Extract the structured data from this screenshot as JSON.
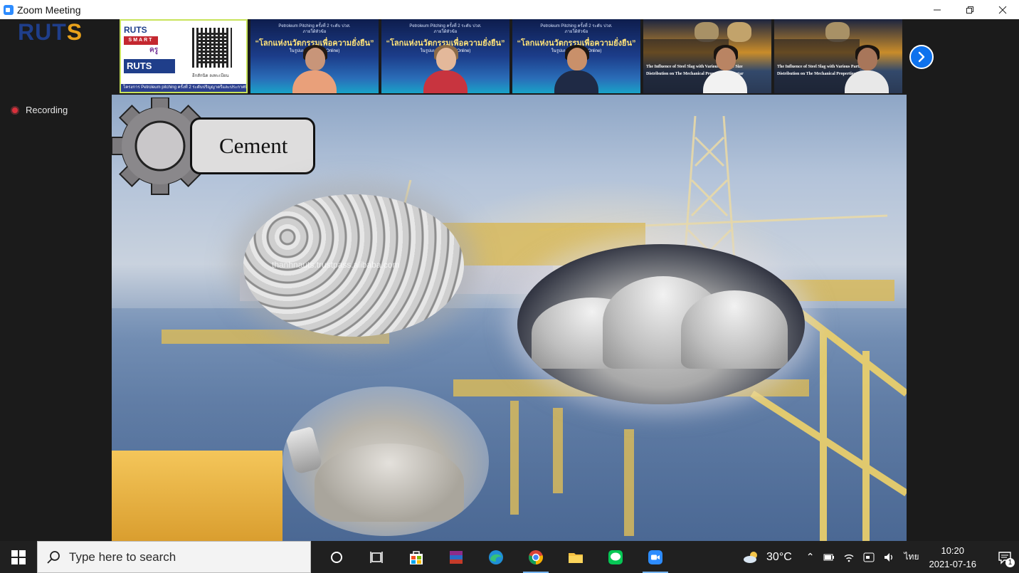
{
  "window": {
    "title": "Zoom Meeting",
    "controls": [
      "minimize",
      "restore",
      "close"
    ]
  },
  "meeting": {
    "logo_text_main": "RUT",
    "logo_text_accent": "S",
    "recording_label": "Recording",
    "next_page_icon": "chevron-right-icon"
  },
  "thumbnails": [
    {
      "type": "poster",
      "rut_small": "RUTS",
      "smart": "SMART",
      "khru": "ครู",
      "ruts_big": "RUTS",
      "caption": "อีกสักนิด ลงทะเบียน",
      "footer": "โครงการ Petroleum pitching ครั้งที่ 2 ระดับปริญญาตรีและประกาศนียบัตรวิชาชีพชั้นสูง"
    },
    {
      "type": "person",
      "line1": "Petroleum Pitching ครั้งที่ 2 ระดับ ปวส.",
      "line2": "ภายใต้หัวข้อ",
      "headline": "“โลกแห่งนวัตกรรมเพื่อความยั่งยืน”",
      "sub": "ในรูปแบบออนไลน์ (Online)",
      "skin": "#c89579",
      "hair": "#241a14",
      "shirt": "#e9a07a"
    },
    {
      "type": "person",
      "line1": "Petroleum Pitching ครั้งที่ 2 ระดับ ปวส.",
      "line2": "ภายใต้หัวข้อ",
      "headline": "“โลกแห่งนวัตกรรมเพื่อความยั่งยืน”",
      "sub": "ในรูปแบบออนไลน์ (Online)",
      "skin": "#e3b89a",
      "hair": "#8a6a48",
      "shirt": "#c8343f"
    },
    {
      "type": "person",
      "line1": "Petroleum Pitching ครั้งที่ 2 ระดับ ปวส.",
      "line2": "ภายใต้หัวข้อ",
      "headline": "“โลกแห่งนวัตกรรมเพื่อความยั่งยืน”",
      "sub": "ในรูปแบบออนไลน์ (Online)",
      "skin": "#c9906a",
      "hair": "#1c1612",
      "shirt": "#1f2a45"
    },
    {
      "type": "oil",
      "text1": "The Influence of Steel Slag with Various Particle Size",
      "text2": "Distribution on The Mechanical Properties of Mortar",
      "skin": "#b98463",
      "hair": "#1a1410",
      "shirt": "#f2f2f2"
    },
    {
      "type": "oil",
      "text1": "The Influence of Steel Slag with Various Particle Size",
      "text2": "Distribution on The Mechanical Properties of Mortar",
      "skin": "#a8765a",
      "hair": "#1a1410",
      "shirt": "#e8e8e8"
    }
  ],
  "slide": {
    "title": "Cement",
    "watermark": "thanhnauts.trustpass.alibaba.com"
  },
  "taskbar": {
    "search_placeholder": "Type here to search",
    "apps": [
      {
        "name": "task-view-icon",
        "running": false
      },
      {
        "name": "task-switch-icon",
        "running": false
      },
      {
        "name": "store-icon",
        "running": false
      },
      {
        "name": "winrar-icon",
        "running": false
      },
      {
        "name": "edge-icon",
        "running": false
      },
      {
        "name": "chrome-icon",
        "running": true
      },
      {
        "name": "file-explorer-icon",
        "running": false
      },
      {
        "name": "line-icon",
        "running": false
      },
      {
        "name": "zoom-icon",
        "running": true
      }
    ],
    "weather_temp": "30°C",
    "language": "ไทย",
    "time": "10:20",
    "date": "2021-07-16",
    "notification_count": "1"
  },
  "colors": {
    "zoom_blue": "#0e72ed",
    "recording_red": "#d9303b",
    "taskbar_bg": "#202020",
    "active_thumb_border": "#c8e35a"
  }
}
